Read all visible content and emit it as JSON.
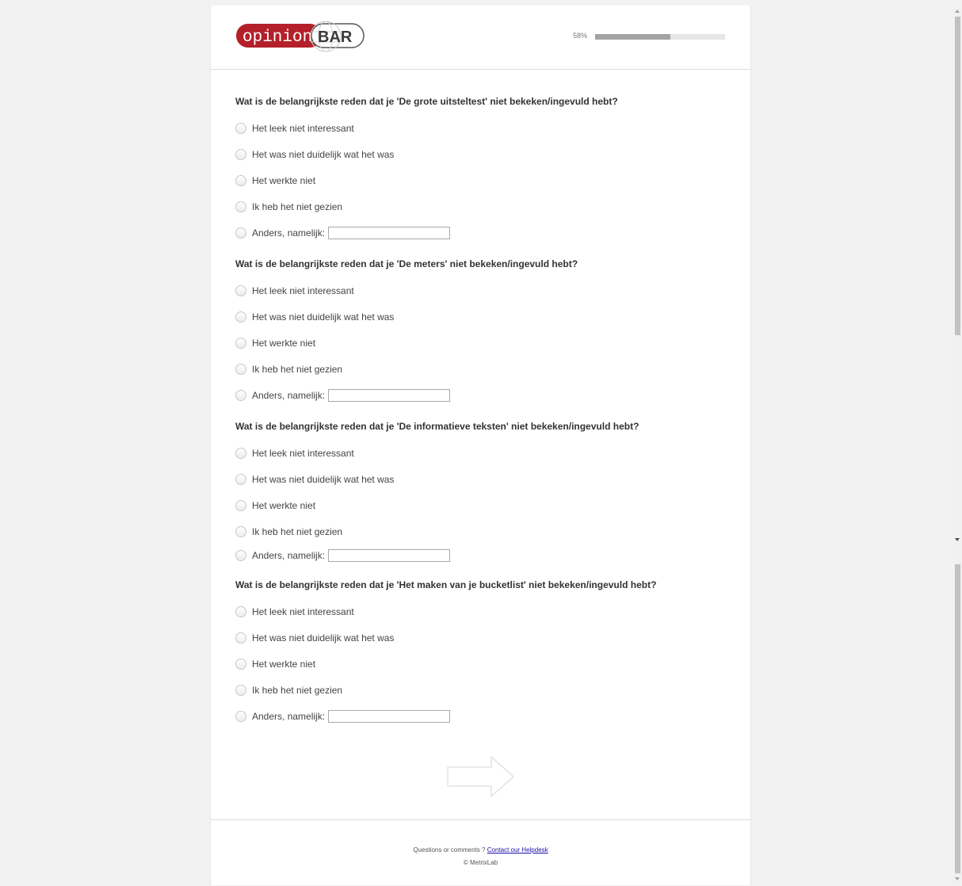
{
  "header": {
    "logo_left": "opinion",
    "logo_right": "BAR",
    "progress_label": "58%",
    "progress_value": 0.58,
    "brand_color": "#b3202a"
  },
  "questions": [
    {
      "title": "Wat is de belangrijkste reden dat je 'De grote uitsteltest' niet bekeken/ingevuld hebt?",
      "options": [
        "Het leek niet interessant",
        "Het was niet duidelijk wat het was",
        "Het werkte niet",
        "Ik heb het niet gezien",
        "Anders, namelijk:"
      ]
    },
    {
      "title": "Wat is de belangrijkste reden dat je 'De meters' niet bekeken/ingevuld hebt?",
      "options": [
        "Het leek niet interessant",
        "Het was niet duidelijk wat het was",
        "Het werkte niet",
        "Ik heb het niet gezien",
        "Anders, namelijk:"
      ]
    },
    {
      "title": "Wat is de belangrijkste reden dat je 'De informatieve teksten' niet bekeken/ingevuld hebt?",
      "options": [
        "Het leek niet interessant",
        "Het was niet duidelijk wat het was",
        "Het werkte niet",
        "Ik heb het niet gezien",
        "Anders, namelijk:"
      ]
    },
    {
      "title": "Wat is de belangrijkste reden dat je 'Het maken van je bucketlist' niet bekeken/ingevuld hebt?",
      "options": [
        "Het leek niet interessant",
        "Het was niet duidelijk wat het was",
        "Het werkte niet",
        "Ik heb het niet gezien",
        "Anders, namelijk:"
      ]
    }
  ],
  "navigation": {
    "next_icon": "right-arrow-icon"
  },
  "footer": {
    "prompt": "Questions or comments ?",
    "link_text": "Contact our Helpdesk",
    "copyright": "© MetrixLab"
  }
}
